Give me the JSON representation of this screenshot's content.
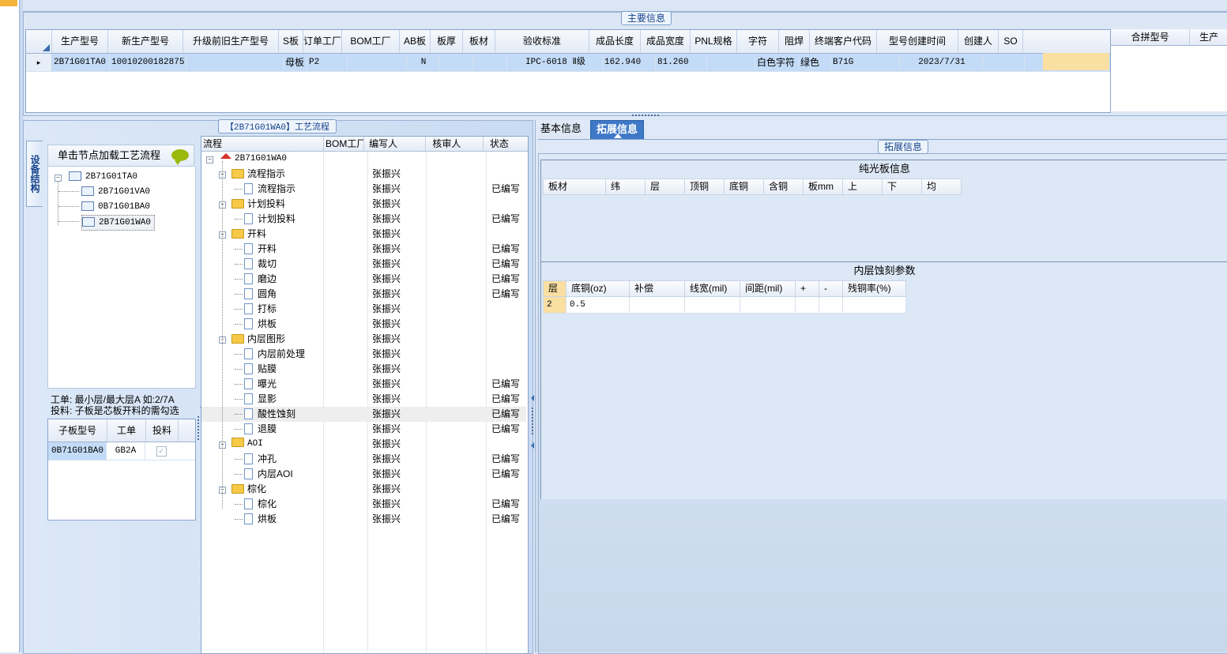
{
  "main_info": {
    "title": "主要信息",
    "columns": [
      "生产型号",
      "新生产型号",
      "升级前旧生产型号",
      "S板",
      "订单工厂",
      "BOM工厂",
      "AB板",
      "板厚",
      "板材",
      "验收标准",
      "成品长度",
      "成品宽度",
      "PNL规格",
      "字符",
      "阻焊",
      "终端客户代码",
      "型号创建时间",
      "创建人",
      "SO"
    ],
    "row": [
      "2B71G01TA0",
      "10010200182875",
      "",
      "母板",
      "P2",
      "",
      "N",
      "",
      "",
      "IPC-6018 Ⅱ级",
      "162.940",
      "81.260",
      "",
      "白色字符",
      "绿色",
      "B71G",
      "2023/7/31",
      "",
      ""
    ],
    "row_marker": "▸"
  },
  "merge_table": {
    "columns": [
      "合拼型号",
      "生产"
    ]
  },
  "process": {
    "title": "【2B71G01WA0】工艺流程",
    "side_tab": "设备结构",
    "click_hint": "单击节点加载工艺流程",
    "tree_nodes": [
      "2B71G01TA0",
      "2B71G01VA0",
      "0B71G01BA0",
      "2B71G01WA0"
    ],
    "hint_lines": [
      "工单: 最小层/最大层A 如:2/7A",
      "投料: 子板是芯板开料的需勾选"
    ],
    "sub_grid": {
      "columns": [
        "子板型号",
        "工单",
        "投料"
      ],
      "row": [
        "0B71G01BA0",
        "GB2A",
        "✓"
      ]
    },
    "tree_columns": [
      "流程",
      "BOM工厂",
      "编写人",
      "核审人",
      "状态"
    ],
    "rows": [
      {
        "label": "2B71G01WA0",
        "writer": "",
        "status": ""
      },
      {
        "label": "流程指示",
        "writer": "张振兴",
        "status": ""
      },
      {
        "label": "流程指示",
        "writer": "张振兴",
        "status": "已编写"
      },
      {
        "label": "计划投料",
        "writer": "张振兴",
        "status": ""
      },
      {
        "label": "计划投料",
        "writer": "张振兴",
        "status": "已编写"
      },
      {
        "label": "开料",
        "writer": "张振兴",
        "status": ""
      },
      {
        "label": "开料",
        "writer": "张振兴",
        "status": "已编写"
      },
      {
        "label": "裁切",
        "writer": "张振兴",
        "status": "已编写"
      },
      {
        "label": "磨边",
        "writer": "张振兴",
        "status": "已编写"
      },
      {
        "label": "圆角",
        "writer": "张振兴",
        "status": "已编写"
      },
      {
        "label": "打标",
        "writer": "张振兴",
        "status": ""
      },
      {
        "label": "烘板",
        "writer": "张振兴",
        "status": ""
      },
      {
        "label": "内层图形",
        "writer": "张振兴",
        "status": ""
      },
      {
        "label": "内层前处理",
        "writer": "张振兴",
        "status": ""
      },
      {
        "label": "贴膜",
        "writer": "张振兴",
        "status": ""
      },
      {
        "label": "曝光",
        "writer": "张振兴",
        "status": "已编写"
      },
      {
        "label": "显影",
        "writer": "张振兴",
        "status": "已编写"
      },
      {
        "label": "酸性蚀刻",
        "writer": "张振兴",
        "status": "已编写"
      },
      {
        "label": "退膜",
        "writer": "张振兴",
        "status": "已编写"
      },
      {
        "label": "AOI",
        "writer": "张振兴",
        "status": ""
      },
      {
        "label": "冲孔",
        "writer": "张振兴",
        "status": "已编写"
      },
      {
        "label": "内层AOI",
        "writer": "张振兴",
        "status": "已编写"
      },
      {
        "label": "棕化",
        "writer": "张振兴",
        "status": ""
      },
      {
        "label": "棕化",
        "writer": "张振兴",
        "status": "已编写"
      },
      {
        "label": "烘板",
        "writer": "张振兴",
        "status": "已编写"
      }
    ]
  },
  "right": {
    "tabs": [
      "基本信息",
      "拓展信息"
    ],
    "group_title": "拓展信息",
    "plain_board": {
      "title": "纯光板信息",
      "columns": [
        "板材",
        "纬",
        "层",
        "顶铜",
        "底铜",
        "含铜",
        "板mm",
        "上",
        "下",
        "均"
      ]
    },
    "inner_etch": {
      "title": "内层蚀刻参数",
      "columns": [
        "层",
        "底铜(oz)",
        "补偿",
        "线宽(mil)",
        "间距(mil)",
        "+",
        "-",
        "残铜率(%)"
      ],
      "row": [
        "2",
        "0.5",
        "",
        "",
        "",
        "",
        "",
        ""
      ]
    }
  },
  "colors": {
    "selected_row": "#c3dbf7",
    "active_tab": "#3e79c8",
    "highlight": "#fadfa3",
    "folder": "#f7c948"
  }
}
